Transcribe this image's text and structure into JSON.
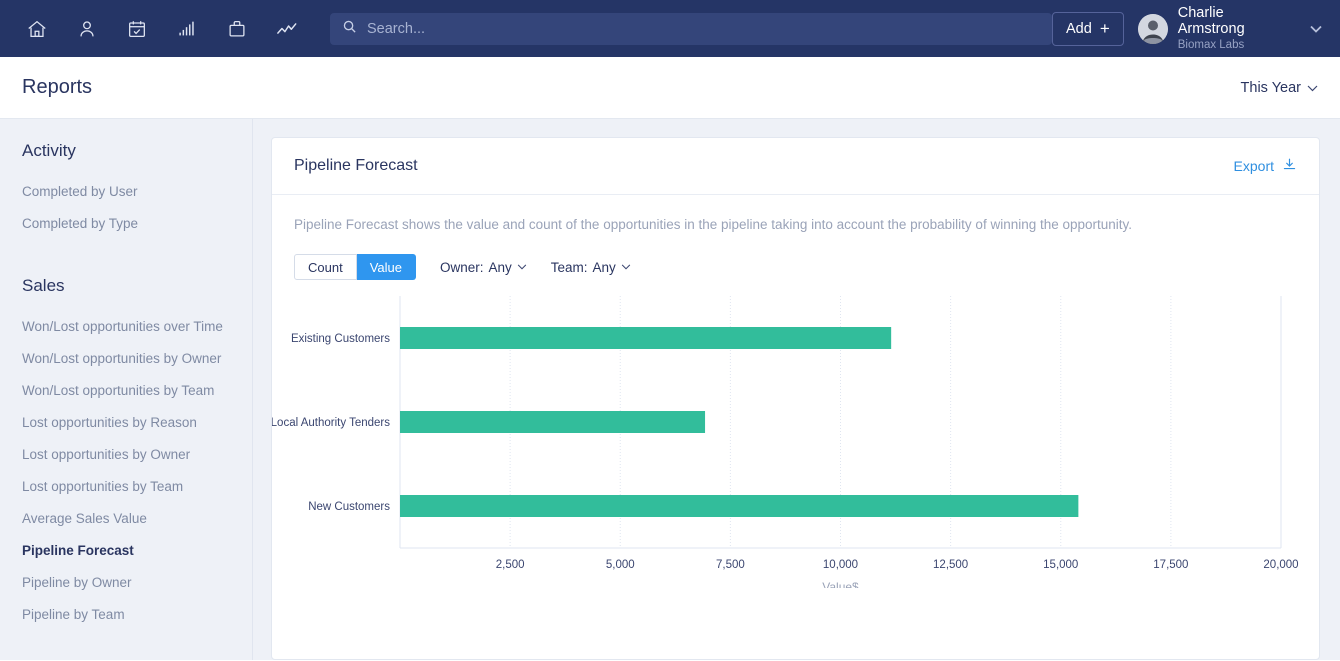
{
  "navbar": {
    "bg_color": "#253566",
    "icons": [
      {
        "name": "home-icon",
        "label": "Home"
      },
      {
        "name": "contacts-icon",
        "label": "Contacts"
      },
      {
        "name": "calendar-check-icon",
        "label": "Calendar"
      },
      {
        "name": "bar-chart-icon",
        "label": "Reports"
      },
      {
        "name": "briefcase-icon",
        "label": "Opportunities"
      },
      {
        "name": "trend-line-icon",
        "label": "Activity"
      }
    ],
    "search": {
      "placeholder": "Search...",
      "value": "",
      "icon": "search-icon"
    },
    "add_button": {
      "label": "Add",
      "plus": "+"
    },
    "user": {
      "name": "Charlie Armstrong",
      "org": "Biomax Labs",
      "avatar": "user-photo-avatar",
      "caret": "▾"
    }
  },
  "page_header": {
    "title": "Reports",
    "period": {
      "label": "This Year",
      "caret": "⌄"
    }
  },
  "sidebar": {
    "groups": [
      {
        "title": "Activity",
        "items": [
          {
            "label": "Completed by User",
            "active": false
          },
          {
            "label": "Completed by Type",
            "active": false
          }
        ]
      },
      {
        "title": "Sales",
        "items": [
          {
            "label": "Won/Lost opportunities over Time",
            "active": false
          },
          {
            "label": "Won/Lost opportunities by Owner",
            "active": false
          },
          {
            "label": "Won/Lost opportunities by Team",
            "active": false
          },
          {
            "label": "Lost opportunities by Reason",
            "active": false
          },
          {
            "label": "Lost opportunities by Owner",
            "active": false
          },
          {
            "label": "Lost opportunities by Team",
            "active": false
          },
          {
            "label": "Average Sales Value",
            "active": false
          },
          {
            "label": "Pipeline Forecast",
            "active": true
          },
          {
            "label": "Pipeline by Owner",
            "active": false
          },
          {
            "label": "Pipeline by Team",
            "active": false
          }
        ]
      }
    ]
  },
  "card": {
    "title": "Pipeline Forecast",
    "export": {
      "label": "Export",
      "icon": "download-icon"
    },
    "description": "Pipeline Forecast shows the value and count of the opportunities in the pipeline taking into account the probability of winning the opportunity.",
    "toolbar": {
      "toggle": {
        "options": [
          {
            "label": "Count",
            "selected": false
          },
          {
            "label": "Value",
            "selected": true
          }
        ]
      },
      "filters": [
        {
          "name": "owner-filter",
          "label": "Owner:",
          "value": "Any",
          "caret": "⌄"
        },
        {
          "name": "team-filter",
          "label": "Team:",
          "value": "Any",
          "caret": "⌄"
        }
      ]
    }
  },
  "chart_data": {
    "type": "bar",
    "orientation": "horizontal",
    "title": "Pipeline Forecast",
    "categories": [
      "Existing Customers",
      "Local Authority Tenders",
      "New Customers"
    ],
    "values": [
      11150,
      6925,
      15400
    ],
    "series": [
      {
        "name": "Value",
        "values": [
          11150,
          6925,
          15400
        ],
        "color": "#32bd9b"
      }
    ],
    "xlabel": "Value$",
    "ylabel": "",
    "xlim": [
      0,
      20000
    ],
    "xticks": [
      0,
      2500,
      5000,
      7500,
      10000,
      12500,
      15000,
      17500,
      20000
    ],
    "xticklabels": [
      "",
      "2,500",
      "5,000",
      "7,500",
      "10,000",
      "12,500",
      "15,000",
      "17,500",
      "20,000"
    ],
    "grid": true,
    "grid_axis": "x",
    "legend": false,
    "bar_color": "#32bd9b"
  }
}
